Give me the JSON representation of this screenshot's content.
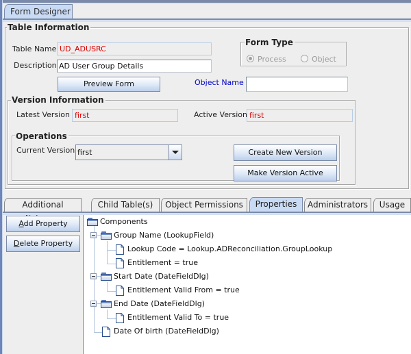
{
  "window": {
    "main_tab": "Form Designer"
  },
  "table_information": {
    "title": "Table Information",
    "table_name_label": "Table Name",
    "table_name_value": "UD_ADUSRC",
    "description_label": "Description",
    "description_value": "AD User Group Details",
    "preview_button": "Preview Form",
    "object_name_label": "Object Name",
    "object_name_value": ""
  },
  "form_type": {
    "title": "Form Type",
    "options": [
      {
        "label": "Process",
        "selected": true,
        "enabled": false
      },
      {
        "label": "Object",
        "selected": false,
        "enabled": false
      }
    ]
  },
  "version_information": {
    "title": "Version Information",
    "latest_version_label": "Latest Version",
    "latest_version_value": "first",
    "active_version_label": "Active Version",
    "active_version_value": "first"
  },
  "operations": {
    "title": "Operations",
    "current_version_label": "Current Version",
    "current_version_value": "first",
    "create_button": "Create New Version",
    "make_active_button": "Make Version Active"
  },
  "sub_tabs": [
    {
      "label": "Additional Columns",
      "active": false
    },
    {
      "label": "Child Table(s)",
      "active": false
    },
    {
      "label": "Object Permissions",
      "active": false
    },
    {
      "label": "Properties",
      "active": true
    },
    {
      "label": "Administrators",
      "active": false
    },
    {
      "label": "Usage",
      "active": false
    }
  ],
  "properties": {
    "add_button_mnemonic": "A",
    "add_button_rest": "dd Property",
    "delete_button_mnemonic": "D",
    "delete_button_rest": "elete Property",
    "tree": [
      {
        "label": "Components",
        "icon": "folder-icon",
        "level": 0
      },
      {
        "label": "Group Name (LookupField)",
        "icon": "folder-icon",
        "level": 1,
        "expanded": true
      },
      {
        "label": "Lookup Code = Lookup.ADReconciliation.GroupLookup",
        "icon": "document-icon",
        "level": 2
      },
      {
        "label": "Entitlement = true",
        "icon": "document-icon",
        "level": 2
      },
      {
        "label": "Start Date (DateFieldDlg)",
        "icon": "folder-icon",
        "level": 1,
        "expanded": true
      },
      {
        "label": "Entitlement Valid From = true",
        "icon": "document-icon",
        "level": 2
      },
      {
        "label": "End Date (DateFieldDlg)",
        "icon": "folder-icon",
        "level": 1,
        "expanded": true
      },
      {
        "label": "Entitlement Valid To = true",
        "icon": "document-icon",
        "level": 2
      },
      {
        "label": "Date Of birth (DateFieldDlg)",
        "icon": "document-icon",
        "level": 1
      }
    ]
  },
  "colors": {
    "accent_blue": "#7a8aa8",
    "tab_active": "#c9dbf4",
    "readonly_text": "#dd0000",
    "link_blue": "#0000cc"
  }
}
